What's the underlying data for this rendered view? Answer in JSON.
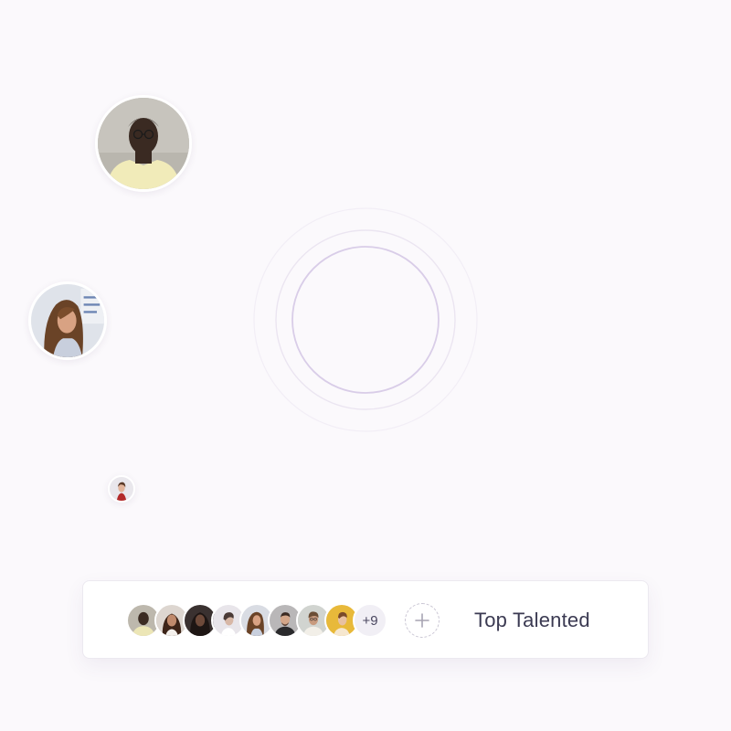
{
  "talent_bar": {
    "more_count": "+9",
    "add_icon": "plus-icon",
    "label": "Top Talented"
  },
  "colors": {
    "background": "#fbf9fc",
    "ring_inner": "#d9cde8",
    "card": "#ffffff",
    "text": "#3b3a52"
  }
}
